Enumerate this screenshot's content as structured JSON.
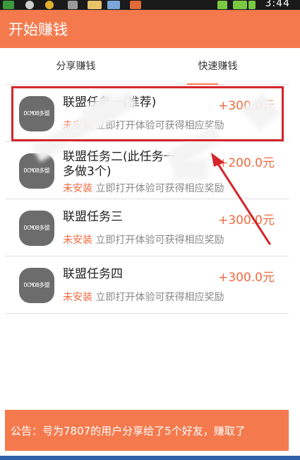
{
  "status_bar": {
    "time": "3:44",
    "icons": [
      "app-notification-icon",
      "search-icon",
      "coin-icon",
      "gallery-icon",
      "message-icon",
      "app-icon",
      "wifi-icon",
      "signal-icon",
      "battery-icon"
    ]
  },
  "app": {
    "title": "开始赚钱",
    "accent": "#f47a4e"
  },
  "tabs": [
    {
      "label": "分享赚钱",
      "active": false
    },
    {
      "label": "快速赚钱",
      "active": true
    }
  ],
  "tasks": [
    {
      "name": "联盟任务一(推荐)",
      "reward": "+300.0元",
      "status": "未安装",
      "desc": "立即打开体验可获得相应奖励",
      "icon": "dcmob-icon",
      "icon_text": "DCMOB多盟"
    },
    {
      "name": "联盟任务二(此任务一",
      "name2": "多做3个)",
      "reward": "+200.0元",
      "status": "未安装",
      "desc": "立即打开体验可获得相应奖励",
      "icon": "dcmob-icon",
      "icon_text": "DCMOB多盟"
    },
    {
      "name": "联盟任务三",
      "reward": "+300.0元",
      "status": "未安装",
      "desc": "立即打开体验可获得相应奖励",
      "icon": "dcmob-icon",
      "icon_text": "DCMOB多盟"
    },
    {
      "name": "联盟任务四",
      "reward": "+300.0元",
      "status": "未安装",
      "desc": "立即打开体验可获得相应奖励",
      "icon": "dcmob-icon",
      "icon_text": "DCMOB多盟"
    }
  ],
  "notice": {
    "text": "公告：号为7807的用户分享给了5个好友，赚取了"
  },
  "annotation_color": "#d4252a"
}
